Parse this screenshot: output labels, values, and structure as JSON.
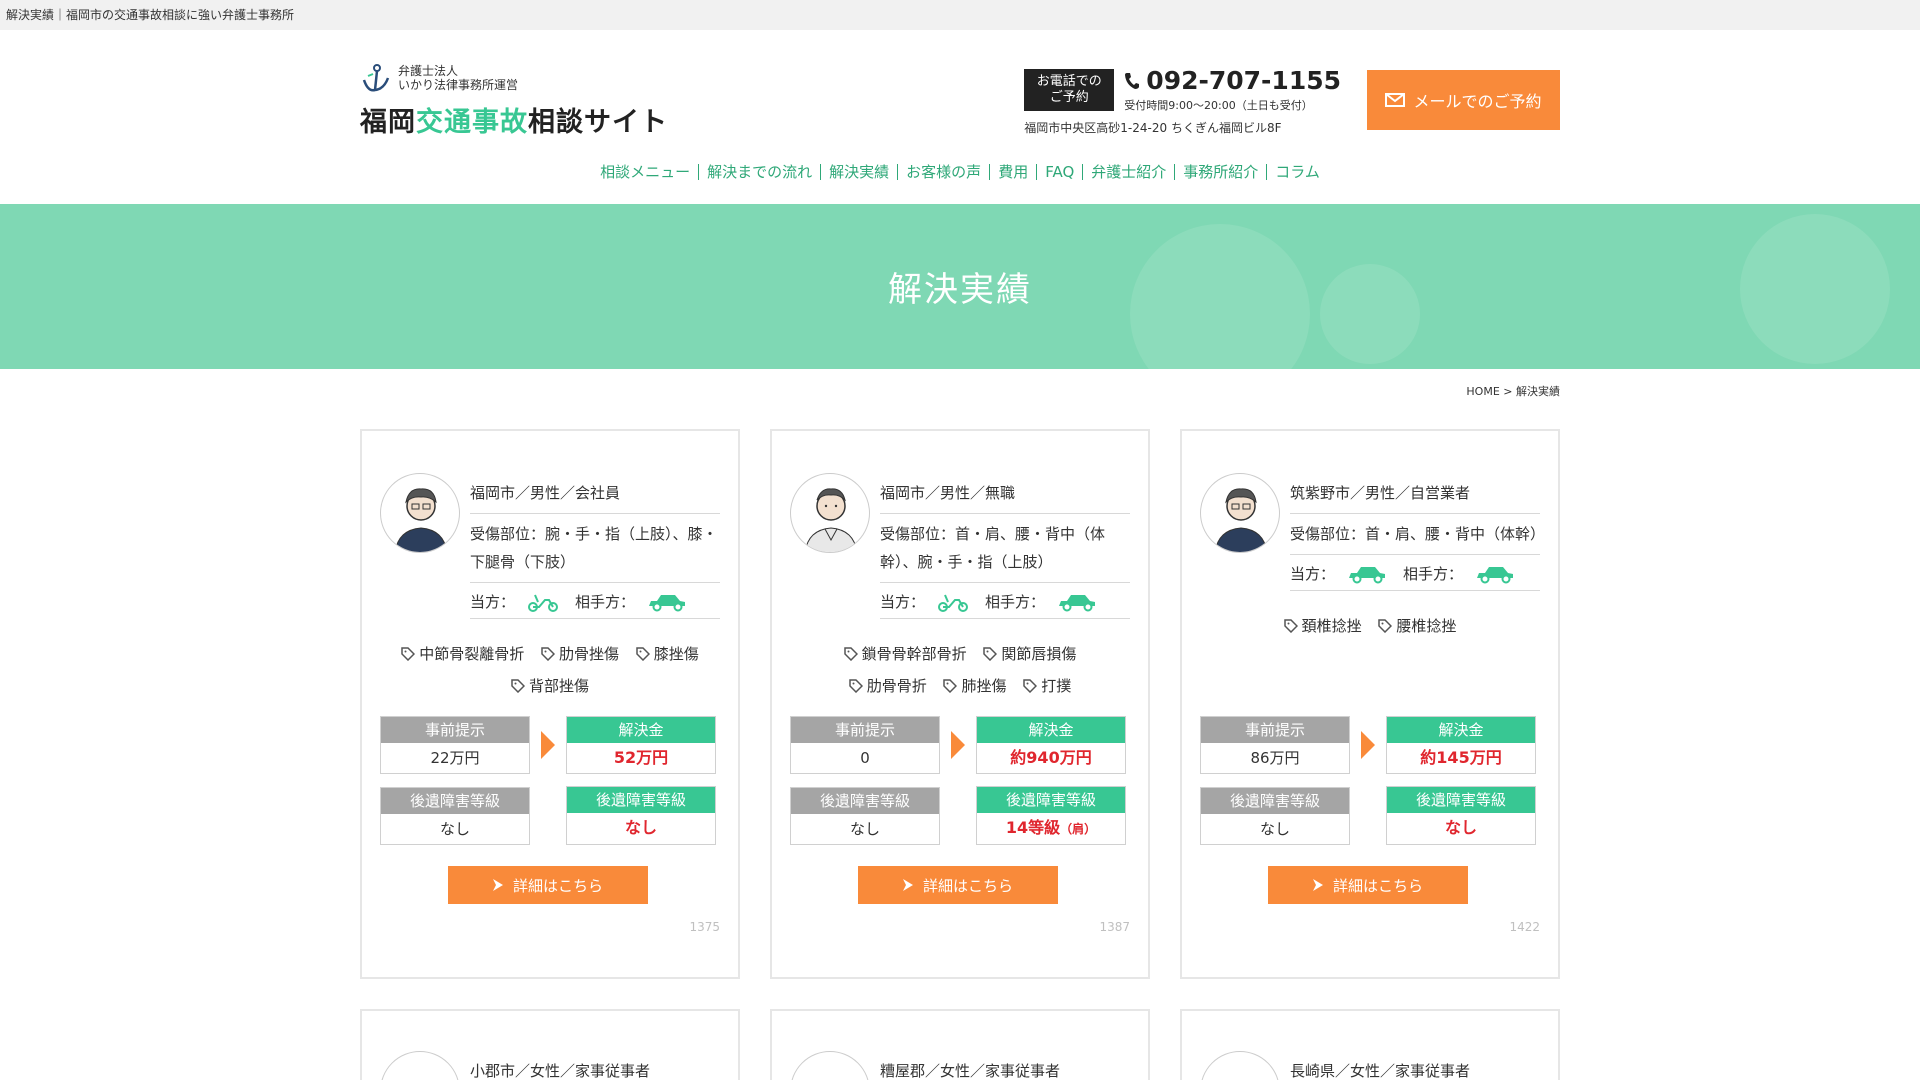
{
  "topstrip": "解決実績｜福岡市の交通事故相談に強い弁護士事務所",
  "logo": {
    "sub1": "弁護士法人",
    "sub2": "いかり法律事務所運営",
    "title_pre": "福岡",
    "title_accent": "交通事故",
    "title_post": "相談サイト"
  },
  "contact": {
    "tel_label1": "お電話での",
    "tel_label2": "ご予約",
    "tel_number": "092-707-1155",
    "hours": "受付時間9:00〜20:00（土日も受付）",
    "address": "福岡市中央区高砂1-24-20 ちくぎん福岡ビル8F",
    "mail_label": "メールでのご予約"
  },
  "nav": [
    "相談メニュー",
    "解決までの流れ",
    "解決実績",
    "お客様の声",
    "費用",
    "FAQ",
    "弁護士紹介",
    "事務所紹介",
    "コラム"
  ],
  "hero_title": "解決実績",
  "breadcrumb": "HOME > 解決実績",
  "labels": {
    "self": "当方：",
    "other": "相手方：",
    "prior": "事前提示",
    "settle": "解決金",
    "grade": "後遺障害等級",
    "detail": "詳細はこちら"
  },
  "cards": [
    {
      "profile": "福岡市／男性／会社員",
      "injury": "受傷部位：腕・手・指（上肢）、膝・下腿骨（下肢）",
      "tags": [
        "中節骨裂離骨折",
        "肋骨挫傷",
        "膝挫傷",
        "背部挫傷"
      ],
      "prior": "22万円",
      "settle": "52万円",
      "prior_grade": "なし",
      "grade": "なし",
      "grade_note": "",
      "id": "1375"
    },
    {
      "profile": "福岡市／男性／無職",
      "injury": "受傷部位：首・肩、腰・背中（体幹）、腕・手・指（上肢）",
      "tags": [
        "鎖骨骨幹部骨折",
        "関節唇損傷",
        "肋骨骨折",
        "肺挫傷",
        "打撲"
      ],
      "prior": "0",
      "settle": "約940万円",
      "prior_grade": "なし",
      "grade": "14等級",
      "grade_note": "（肩）",
      "id": "1387"
    },
    {
      "profile": "筑紫野市／男性／自営業者",
      "injury": "受傷部位：首・肩、腰・背中（体幹）",
      "tags": [
        "頚椎捻挫",
        "腰椎捻挫"
      ],
      "prior": "86万円",
      "settle": "約145万円",
      "prior_grade": "なし",
      "grade": "なし",
      "grade_note": "",
      "id": "1422"
    }
  ],
  "cards_row2": [
    {
      "profile": "小郡市／女性／家事従事者"
    },
    {
      "profile": "糟屋郡／女性／家事従事者"
    },
    {
      "profile": "長崎県／女性／家事従事者"
    }
  ],
  "colors": {
    "accent": "#38c793",
    "orange": "#f98a3a",
    "red": "#e0262e"
  }
}
